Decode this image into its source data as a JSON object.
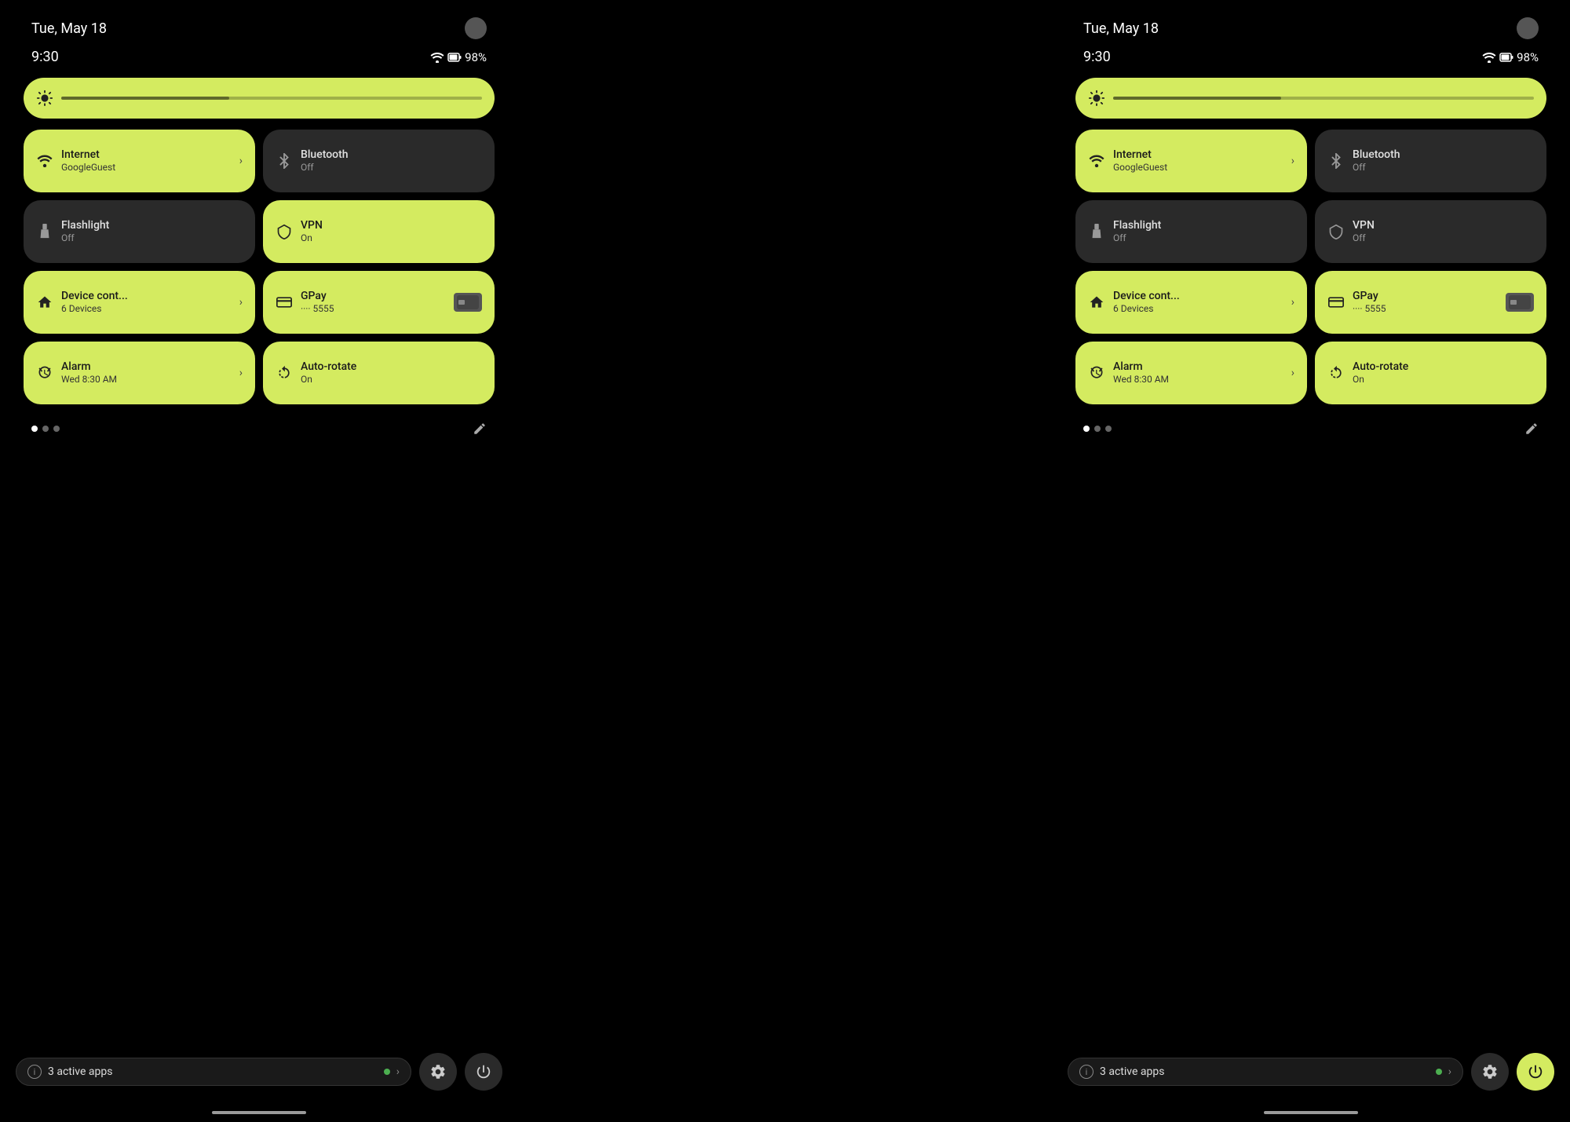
{
  "panel1": {
    "date": "Tue, May 18",
    "time": "9:30",
    "battery": "98%",
    "brightness_icon": "⚙",
    "tiles": [
      {
        "id": "internet",
        "title": "Internet",
        "subtitle": "GoogleGuest",
        "state": "active",
        "icon": "wifi",
        "has_arrow": true
      },
      {
        "id": "bluetooth",
        "title": "Bluetooth",
        "subtitle": "Off",
        "state": "inactive",
        "icon": "bt",
        "has_arrow": false
      },
      {
        "id": "flashlight",
        "title": "Flashlight",
        "subtitle": "Off",
        "state": "inactive",
        "icon": "flashlight",
        "has_arrow": false
      },
      {
        "id": "vpn",
        "title": "VPN",
        "subtitle": "On",
        "state": "active",
        "icon": "vpn",
        "has_arrow": false
      },
      {
        "id": "device",
        "title": "Device cont...",
        "subtitle": "6 Devices",
        "state": "active",
        "icon": "home",
        "has_arrow": true
      },
      {
        "id": "gpay",
        "title": "GPay",
        "subtitle": "···· 5555",
        "state": "active",
        "icon": "card",
        "has_arrow": false
      },
      {
        "id": "alarm",
        "title": "Alarm",
        "subtitle": "Wed 8:30 AM",
        "state": "active",
        "icon": "alarm",
        "has_arrow": true
      },
      {
        "id": "autorotate",
        "title": "Auto-rotate",
        "subtitle": "On",
        "state": "active",
        "icon": "rotate",
        "has_arrow": false
      }
    ],
    "dots": [
      true,
      false,
      false
    ],
    "bottom": {
      "active_apps_label": "3 active apps",
      "power_btn_type": "dark"
    }
  },
  "panel2": {
    "date": "Tue, May 18",
    "time": "9:30",
    "battery": "98%",
    "brightness_icon": "⚙",
    "tiles": [
      {
        "id": "internet",
        "title": "Internet",
        "subtitle": "GoogleGuest",
        "state": "active",
        "icon": "wifi",
        "has_arrow": true
      },
      {
        "id": "bluetooth",
        "title": "Bluetooth",
        "subtitle": "Off",
        "state": "inactive",
        "icon": "bt",
        "has_arrow": false
      },
      {
        "id": "flashlight",
        "title": "Flashlight",
        "subtitle": "Off",
        "state": "inactive",
        "icon": "flashlight",
        "has_arrow": false
      },
      {
        "id": "vpn",
        "title": "VPN",
        "subtitle": "Off",
        "state": "inactive",
        "icon": "vpn",
        "has_arrow": false
      },
      {
        "id": "device",
        "title": "Device cont...",
        "subtitle": "6 Devices",
        "state": "active",
        "icon": "home",
        "has_arrow": true
      },
      {
        "id": "gpay",
        "title": "GPay",
        "subtitle": "···· 5555",
        "state": "active",
        "icon": "card",
        "has_arrow": false
      },
      {
        "id": "alarm",
        "title": "Alarm",
        "subtitle": "Wed 8:30 AM",
        "state": "active",
        "icon": "alarm",
        "has_arrow": true
      },
      {
        "id": "autorotate",
        "title": "Auto-rotate",
        "subtitle": "On",
        "state": "active",
        "icon": "rotate",
        "has_arrow": false
      }
    ],
    "dots": [
      true,
      false,
      false
    ],
    "bottom": {
      "active_apps_label": "3 active apps",
      "power_btn_type": "light"
    }
  },
  "colors": {
    "active_tile": "#d4eb60",
    "inactive_tile": "#2a2a2a",
    "background": "#000000"
  }
}
